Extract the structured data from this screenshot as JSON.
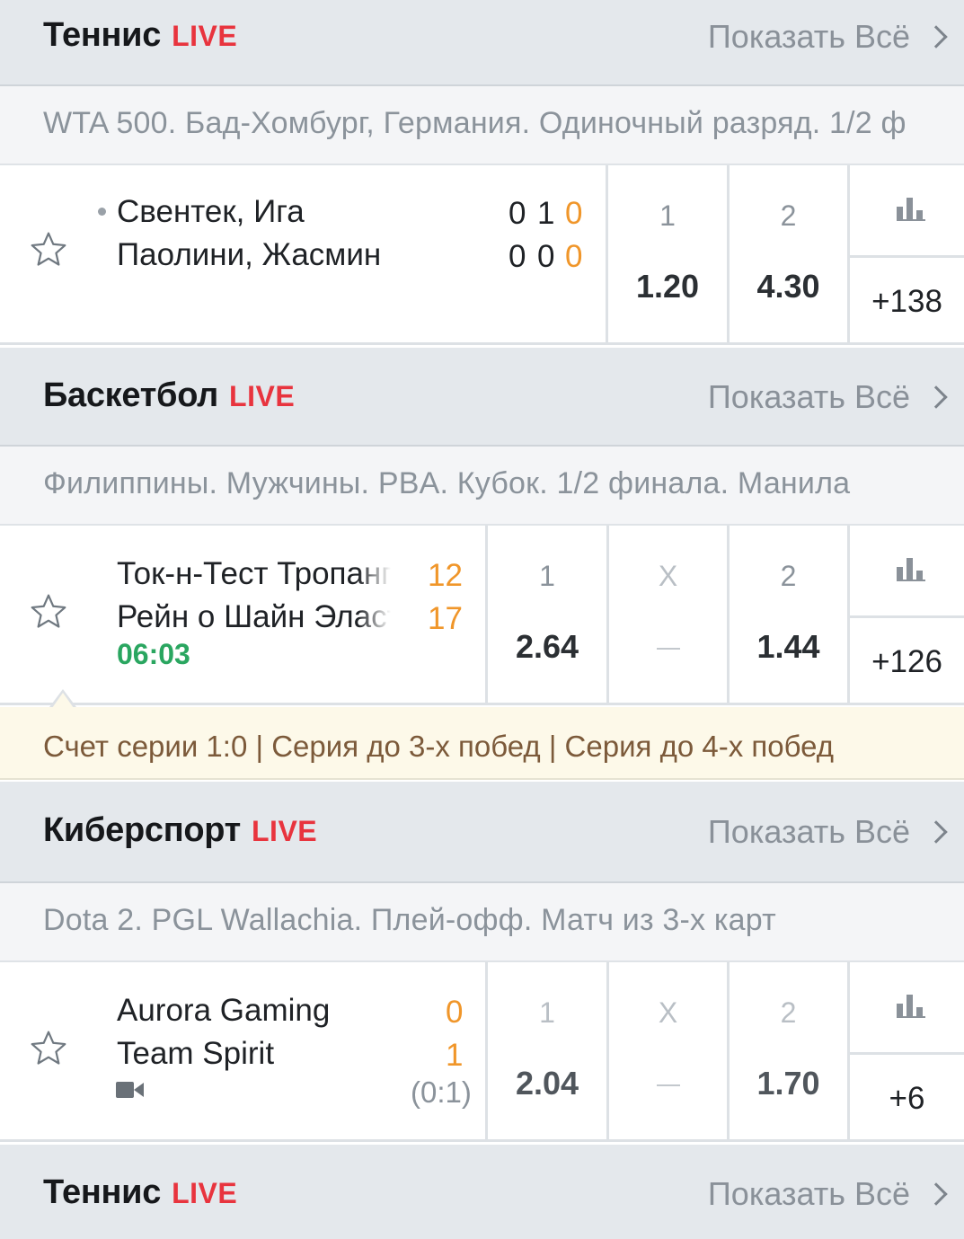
{
  "labels": {
    "live": "LIVE",
    "show_all": "Показать Всё",
    "odd_1": "1",
    "odd_x": "X",
    "odd_2": "2"
  },
  "sections": [
    {
      "sport": "Теннис",
      "league": "WTA 500. Бад-Хомбург, Германия. Одиночный разряд. 1/2 ф",
      "event": {
        "team1": "Свентек, Ига",
        "team2": "Паолини, Жасмин",
        "scores_team1": [
          "0",
          "1",
          "0"
        ],
        "scores_team2": [
          "0",
          "0",
          "0"
        ],
        "odd_1": "1.20",
        "odd_2": "4.30",
        "more": "+138"
      }
    },
    {
      "sport": "Баскетбол",
      "league": "Филиппины. Мужчины. PBA. Кубок. 1/2 финала. Манила",
      "event": {
        "team1": "Ток-н-Тест Тропанг",
        "team2": "Рейн о Шайн Эласто",
        "score1": "12",
        "score2": "17",
        "time": "06:03",
        "odd_1": "2.64",
        "odd_2": "1.44",
        "more": "+126"
      },
      "info": "Счет серии 1:0 | Серия до 3-х побед | Серия до 4-х побед"
    },
    {
      "sport": "Киберспорт",
      "league": "Dota 2. PGL Wallachia. Плей-офф. Матч из 3-х карт",
      "event": {
        "team1": "Aurora Gaming",
        "team2": "Team Spirit",
        "score1": "0",
        "score2": "1",
        "map_score": "(0:1)",
        "odd_1": "2.04",
        "odd_2": "1.70",
        "more": "+6"
      }
    },
    {
      "sport": "Теннис"
    }
  ],
  "colors": {
    "live": "#e8343e",
    "score_orange": "#f0962a",
    "time_green": "#2aa660",
    "header_bg": "#e4e8ec",
    "info_bg": "#fdf9e9"
  },
  "icons": [
    "star-icon",
    "chevron-right-icon",
    "bar-chart-icon",
    "video-camera-icon"
  ]
}
